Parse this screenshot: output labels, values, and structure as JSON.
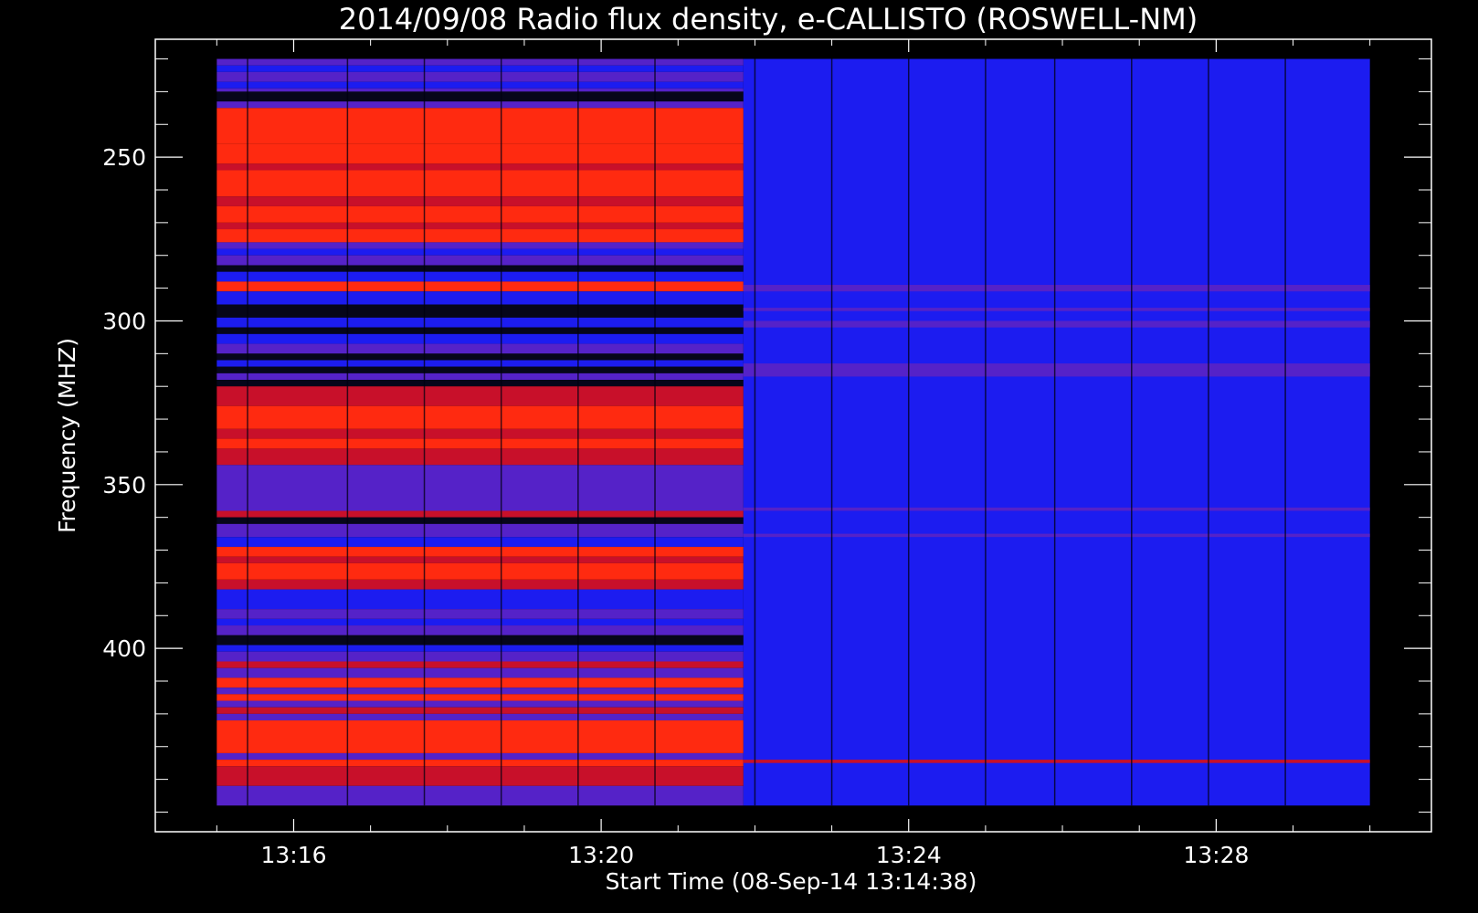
{
  "chart_data": {
    "type": "heatmap",
    "title": "2014/09/08  Radio flux density, e-CALLISTO (ROSWELL-NM)",
    "xlabel": "Start Time (08-Sep-14 13:14:38)",
    "ylabel": "Frequency (MHZ)",
    "x_ticks": [
      {
        "label": "13:16",
        "value": 1.0
      },
      {
        "label": "13:20",
        "value": 5.0
      },
      {
        "label": "13:24",
        "value": 9.0
      },
      {
        "label": "13:28",
        "value": 13.0
      }
    ],
    "y_ticks": [
      {
        "label": "250",
        "value": 250
      },
      {
        "label": "300",
        "value": 300
      },
      {
        "label": "350",
        "value": 350
      },
      {
        "label": "400",
        "value": 400
      }
    ],
    "xlim": [
      -0.8,
      15.8
    ],
    "ylim": [
      456,
      214
    ],
    "data_time_range": [
      0.0,
      15.0
    ],
    "data_freq_range": [
      220,
      448
    ],
    "transition_time": 6.85,
    "colors": {
      "background": "#000000",
      "strong": "#ff2a10",
      "medium": "#c8102a",
      "weak": "#5522c8",
      "quiet": "#1c1cf0",
      "gap": "#06061a",
      "grid_line": "#000010"
    },
    "early_bands": [
      {
        "from": 220,
        "to": 222,
        "level": "weak"
      },
      {
        "from": 222,
        "to": 224,
        "level": "quiet"
      },
      {
        "from": 224,
        "to": 227,
        "level": "weak"
      },
      {
        "from": 227,
        "to": 229,
        "level": "quiet"
      },
      {
        "from": 229,
        "to": 230,
        "level": "weak"
      },
      {
        "from": 230,
        "to": 233,
        "level": "gap"
      },
      {
        "from": 233,
        "to": 235,
        "level": "weak"
      },
      {
        "from": 235,
        "to": 246,
        "level": "strong"
      },
      {
        "from": 246,
        "to": 252,
        "level": "strong"
      },
      {
        "from": 252,
        "to": 254,
        "level": "medium"
      },
      {
        "from": 254,
        "to": 262,
        "level": "strong"
      },
      {
        "from": 262,
        "to": 265,
        "level": "medium"
      },
      {
        "from": 265,
        "to": 270,
        "level": "strong"
      },
      {
        "from": 270,
        "to": 272,
        "level": "medium"
      },
      {
        "from": 272,
        "to": 276,
        "level": "strong"
      },
      {
        "from": 276,
        "to": 278,
        "level": "weak"
      },
      {
        "from": 278,
        "to": 280,
        "level": "quiet"
      },
      {
        "from": 280,
        "to": 283,
        "level": "weak"
      },
      {
        "from": 283,
        "to": 285,
        "level": "gap"
      },
      {
        "from": 285,
        "to": 288,
        "level": "quiet"
      },
      {
        "from": 288,
        "to": 291,
        "level": "strong"
      },
      {
        "from": 291,
        "to": 295,
        "level": "quiet"
      },
      {
        "from": 295,
        "to": 299,
        "level": "gap"
      },
      {
        "from": 299,
        "to": 302,
        "level": "quiet"
      },
      {
        "from": 302,
        "to": 304,
        "level": "gap"
      },
      {
        "from": 304,
        "to": 307,
        "level": "quiet"
      },
      {
        "from": 307,
        "to": 310,
        "level": "weak"
      },
      {
        "from": 310,
        "to": 312,
        "level": "gap"
      },
      {
        "from": 312,
        "to": 314,
        "level": "quiet"
      },
      {
        "from": 314,
        "to": 316,
        "level": "gap"
      },
      {
        "from": 316,
        "to": 318,
        "level": "weak"
      },
      {
        "from": 318,
        "to": 320,
        "level": "gap"
      },
      {
        "from": 320,
        "to": 326,
        "level": "medium"
      },
      {
        "from": 326,
        "to": 333,
        "level": "strong"
      },
      {
        "from": 333,
        "to": 336,
        "level": "medium"
      },
      {
        "from": 336,
        "to": 339,
        "level": "strong"
      },
      {
        "from": 339,
        "to": 344,
        "level": "medium"
      },
      {
        "from": 344,
        "to": 358,
        "level": "weak"
      },
      {
        "from": 358,
        "to": 360,
        "level": "medium"
      },
      {
        "from": 360,
        "to": 362,
        "level": "gap"
      },
      {
        "from": 362,
        "to": 366,
        "level": "weak"
      },
      {
        "from": 366,
        "to": 369,
        "level": "quiet"
      },
      {
        "from": 369,
        "to": 372,
        "level": "strong"
      },
      {
        "from": 372,
        "to": 374,
        "level": "medium"
      },
      {
        "from": 374,
        "to": 379,
        "level": "strong"
      },
      {
        "from": 379,
        "to": 382,
        "level": "medium"
      },
      {
        "from": 382,
        "to": 388,
        "level": "quiet"
      },
      {
        "from": 388,
        "to": 391,
        "level": "weak"
      },
      {
        "from": 391,
        "to": 393,
        "level": "quiet"
      },
      {
        "from": 393,
        "to": 396,
        "level": "weak"
      },
      {
        "from": 396,
        "to": 399,
        "level": "gap"
      },
      {
        "from": 399,
        "to": 401,
        "level": "quiet"
      },
      {
        "from": 401,
        "to": 404,
        "level": "weak"
      },
      {
        "from": 404,
        "to": 406,
        "level": "medium"
      },
      {
        "from": 406,
        "to": 409,
        "level": "weak"
      },
      {
        "from": 409,
        "to": 412,
        "level": "strong"
      },
      {
        "from": 412,
        "to": 414,
        "level": "weak"
      },
      {
        "from": 414,
        "to": 416,
        "level": "strong"
      },
      {
        "from": 416,
        "to": 418,
        "level": "weak"
      },
      {
        "from": 418,
        "to": 420,
        "level": "medium"
      },
      {
        "from": 420,
        "to": 422,
        "level": "weak"
      },
      {
        "from": 422,
        "to": 432,
        "level": "strong"
      },
      {
        "from": 432,
        "to": 434,
        "level": "weak"
      },
      {
        "from": 434,
        "to": 436,
        "level": "strong"
      },
      {
        "from": 436,
        "to": 442,
        "level": "medium"
      },
      {
        "from": 442,
        "to": 448,
        "level": "weak"
      }
    ],
    "late_bands": [
      {
        "from": 220,
        "to": 448,
        "level": "quiet"
      },
      {
        "from": 289,
        "to": 291,
        "level": "weak"
      },
      {
        "from": 296,
        "to": 297,
        "level": "weak"
      },
      {
        "from": 300,
        "to": 302,
        "level": "weak"
      },
      {
        "from": 313,
        "to": 317,
        "level": "weak"
      },
      {
        "from": 357,
        "to": 358,
        "level": "weak"
      },
      {
        "from": 365,
        "to": 366,
        "level": "weak"
      },
      {
        "from": 434,
        "to": 435,
        "level": "medium"
      }
    ],
    "column_gaps": [
      0.4,
      1.7,
      2.7,
      3.7,
      4.7,
      5.7,
      7.0,
      8.0,
      9.0,
      10.0,
      10.9,
      11.9,
      12.9,
      13.9
    ]
  }
}
